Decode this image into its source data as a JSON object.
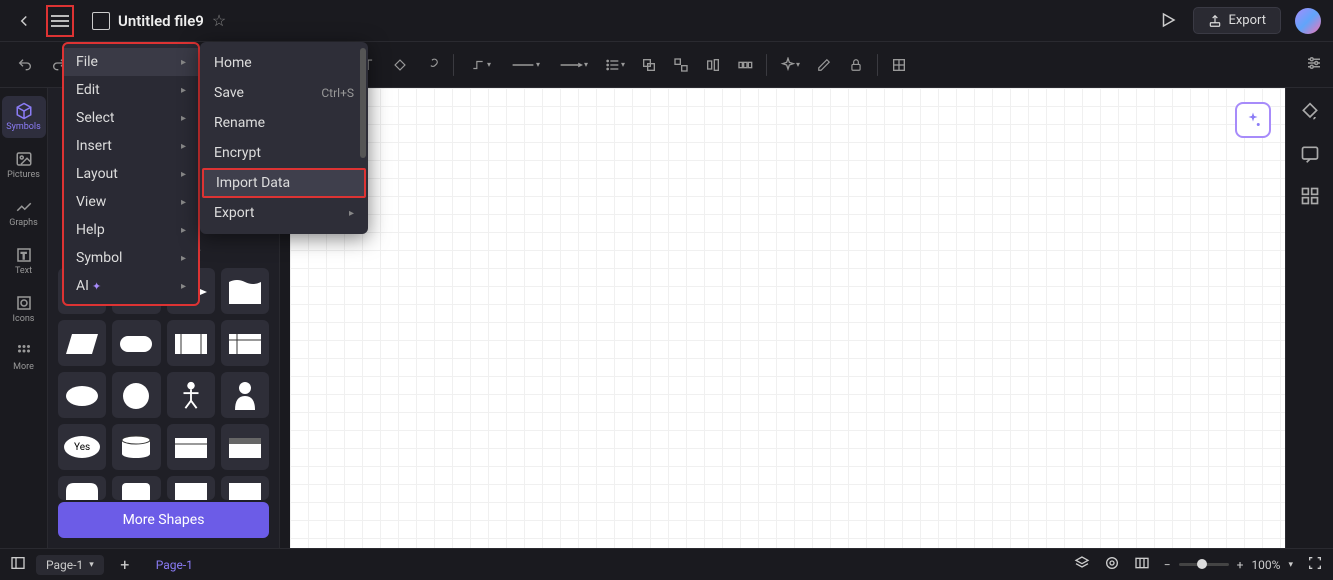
{
  "header": {
    "filename": "Untitled file9",
    "export_label": "Export"
  },
  "main_menu": {
    "items": [
      {
        "label": "File",
        "has_sub": true
      },
      {
        "label": "Edit",
        "has_sub": true
      },
      {
        "label": "Select",
        "has_sub": true
      },
      {
        "label": "Insert",
        "has_sub": true
      },
      {
        "label": "Layout",
        "has_sub": true
      },
      {
        "label": "View",
        "has_sub": true
      },
      {
        "label": "Help",
        "has_sub": true
      },
      {
        "label": "Symbol",
        "has_sub": true
      },
      {
        "label": "AI",
        "has_sub": true,
        "sparkle": true
      }
    ]
  },
  "file_submenu": {
    "items": [
      {
        "label": "Home"
      },
      {
        "label": "Save",
        "shortcut": "Ctrl+S"
      },
      {
        "label": "Rename"
      },
      {
        "label": "Encrypt"
      },
      {
        "label": "Import Data",
        "highlighted": true
      },
      {
        "label": "Export",
        "has_sub": true
      }
    ]
  },
  "leftrail": {
    "items": [
      {
        "label": "Symbols",
        "icon": "cube-icon"
      },
      {
        "label": "Pictures",
        "icon": "image-icon"
      },
      {
        "label": "Graphs",
        "icon": "chart-icon"
      },
      {
        "label": "Text",
        "icon": "text-icon"
      },
      {
        "label": "Icons",
        "icon": "target-icon"
      },
      {
        "label": "More",
        "icon": "grid-icon"
      }
    ]
  },
  "shapes": {
    "more_label": "More Shapes",
    "yes_label": "Yes"
  },
  "bottombar": {
    "page_selector": "Page-1",
    "page_tab": "Page-1",
    "zoom": "100%"
  }
}
